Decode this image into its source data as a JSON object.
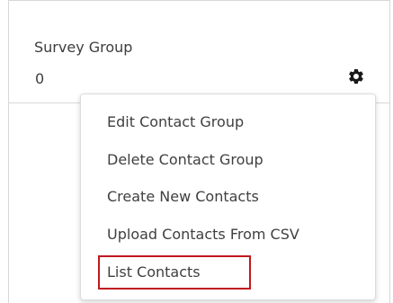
{
  "card": {
    "title": "Survey Group",
    "count": "0",
    "settings_icon": "gear-icon"
  },
  "menu": {
    "items": [
      {
        "label": "Edit Contact Group"
      },
      {
        "label": "Delete Contact Group"
      },
      {
        "label": "Create New Contacts"
      },
      {
        "label": "Upload Contacts From CSV"
      },
      {
        "label": "List Contacts"
      }
    ],
    "highlighted_item_index": 4
  },
  "colors": {
    "text": "#3f3f3f",
    "border": "#d8d8d8",
    "highlight": "#c0181f",
    "icon": "#1a1a1a"
  }
}
